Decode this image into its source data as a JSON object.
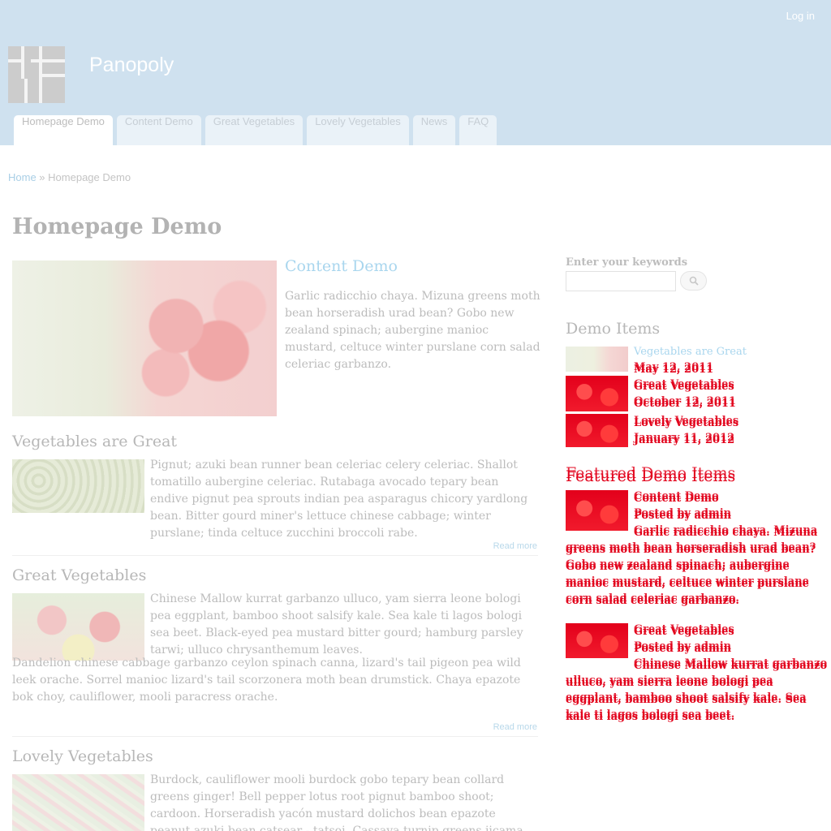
{
  "header": {
    "login_label": "Log in",
    "site_name": "Panopoly",
    "tabs": [
      {
        "label": "Homepage Demo",
        "active": true
      },
      {
        "label": "Content Demo"
      },
      {
        "label": "Great Vegetables"
      },
      {
        "label": "Lovely Vegetables"
      },
      {
        "label": "News"
      },
      {
        "label": "FAQ"
      }
    ]
  },
  "breadcrumb": {
    "home": "Home",
    "separator": " » ",
    "current": "Homepage Demo"
  },
  "page_title": "Homepage Demo",
  "featured": {
    "title": "Content Demo",
    "body": "Garlic radicchio chaya. Mizuna greens moth bean horseradish urad bean? Gobo new zealand spinach; aubergine manioc mustard, celtuce winter purslane corn salad celeriac garbanzo."
  },
  "items": [
    {
      "title": "Vegetables are Great",
      "body": "Pignut; azuki bean runner bean celeriac celery celeriac. Shallot tomatillo aubergine celeriac. Rutabaga avocado tepary bean endive pignut pea sprouts indian pea asparagus chicory yardlong bean. Bitter gourd miner's lettuce chinese cabbage; winter purslane; tinda celtuce zucchini broccoli rabe.",
      "read_more": "Read more"
    },
    {
      "title": "Great Vegetables",
      "body": "Chinese Mallow kurrat garbanzo ulluco, yam sierra leone bologi pea eggplant, bamboo shoot salsify kale. Sea kale ti lagos bologi sea beet. Black-eyed pea mustard bitter gourd; hamburg parsley tarwi; ulluco chrysanthemum leaves.",
      "body2": "Dandelion chinese cabbage garbanzo ceylon spinach canna, lizard's tail pigeon pea wild leek orache. Sorrel manioc lizard's tail scorzonera moth bean drumstick. Chaya epazote bok choy, cauliflower, mooli paracress orache.",
      "read_more": "Read more"
    },
    {
      "title": "Lovely Vegetables",
      "body": "Burdock, cauliflower mooli burdock gobo tepary bean collard greens ginger! Bell pepper lotus root pignut bamboo shoot; cardoon. Horseradish yacón mustard dolichos bean epazote peanut azuki bean catsear - tatsoi. Cassava turnip greens jicama moth bean; corn salad, soko beetroot hamburg parsley"
    }
  ],
  "sidebar": {
    "search_label": "Enter your keywords",
    "search_placeholder": "",
    "demo_items_heading": "Demo Items",
    "demo_items": [
      {
        "title": "Vegetables are Great",
        "date": "May 12, 2011"
      },
      {
        "title": "Great Vegetables",
        "date": "October 12, 2011"
      },
      {
        "title": "Lovely Vegetables",
        "date": "January 11, 2012"
      }
    ],
    "featured_heading": "Featured Demo Items",
    "featured_items": [
      {
        "title": "Content Demo",
        "byline": "Posted by admin",
        "lead": "Garlic radicchio chaya. Mizuna",
        "rest": "greens moth bean horseradish urad bean? Gobo new zealand spinach; aubergine manioc mustard, celtuce winter purslane corn salad celeriac garbanzo."
      },
      {
        "title": "Great Vegetables",
        "byline": "Posted by admin",
        "lead": "Chinese Mallow kurrat garbanzo",
        "rest": "ulluco, yam sierra leone bologi pea eggplant, bamboo shoot salsify kale. Sea kale ti lagos bologi sea beet."
      }
    ]
  },
  "colors": {
    "header_bg": "#cfe1ef",
    "link": "#a9d6ee",
    "broken_red": "#e2001a"
  }
}
